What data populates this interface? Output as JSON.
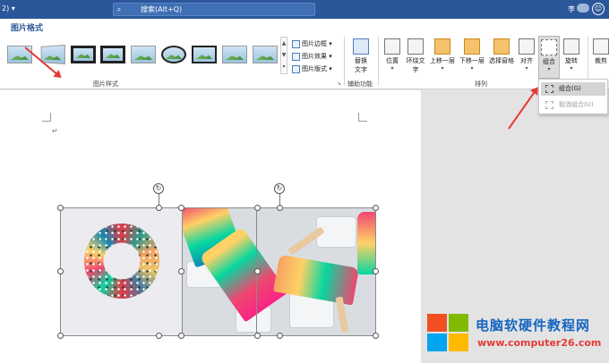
{
  "titlebar": {
    "left_text": "2) ▾",
    "search_placeholder": "搜索(Alt+Q)",
    "user": "李",
    "avatar": "☺"
  },
  "tabs": [
    {
      "label": "图片格式",
      "active": true
    }
  ],
  "ribbon": {
    "picture_styles_label": "图片样式",
    "border_label": "图片边框",
    "effects_label": "图片效果",
    "layout_label": "图片版式",
    "alt_text_label": "替换\n文字",
    "accessibility_label": "辅助功能",
    "arrange_label": "排列",
    "position_label": "位置",
    "wrap_label": "环绕文\n字",
    "bring_forward_label": "上移一层",
    "send_backward_label": "下移一层",
    "selection_pane_label": "选择窗格",
    "align_label": "对齐",
    "group_label": "组合",
    "rotate_label": "旋转",
    "crop_label": "裁剪"
  },
  "group_menu": {
    "group_item": "组合(G)",
    "ungroup_item": "取消组合(U)"
  },
  "document": {
    "paragraph_mark": "↵"
  },
  "watermark": {
    "site_name": "电脑软硬件教程网",
    "url": "www.computer26.com"
  },
  "colors": {
    "title_blue": "#2b579a",
    "arrow_red": "#e53935"
  }
}
